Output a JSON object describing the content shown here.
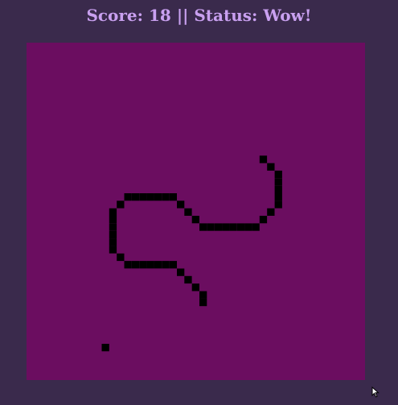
{
  "hud": {
    "score_label": "Score:",
    "score": "18",
    "separator": "||",
    "status_label": "Status:",
    "status": "Wow!"
  },
  "game": {
    "score_value": 18,
    "colors": {
      "page_background": "#3a2a4c",
      "board_background": "#6b0d60",
      "snake": "#000000",
      "food": "#000000",
      "hud_text": "#c9a0f0"
    },
    "icons": {
      "cursor": "mouse-pointer-icon"
    }
  }
}
